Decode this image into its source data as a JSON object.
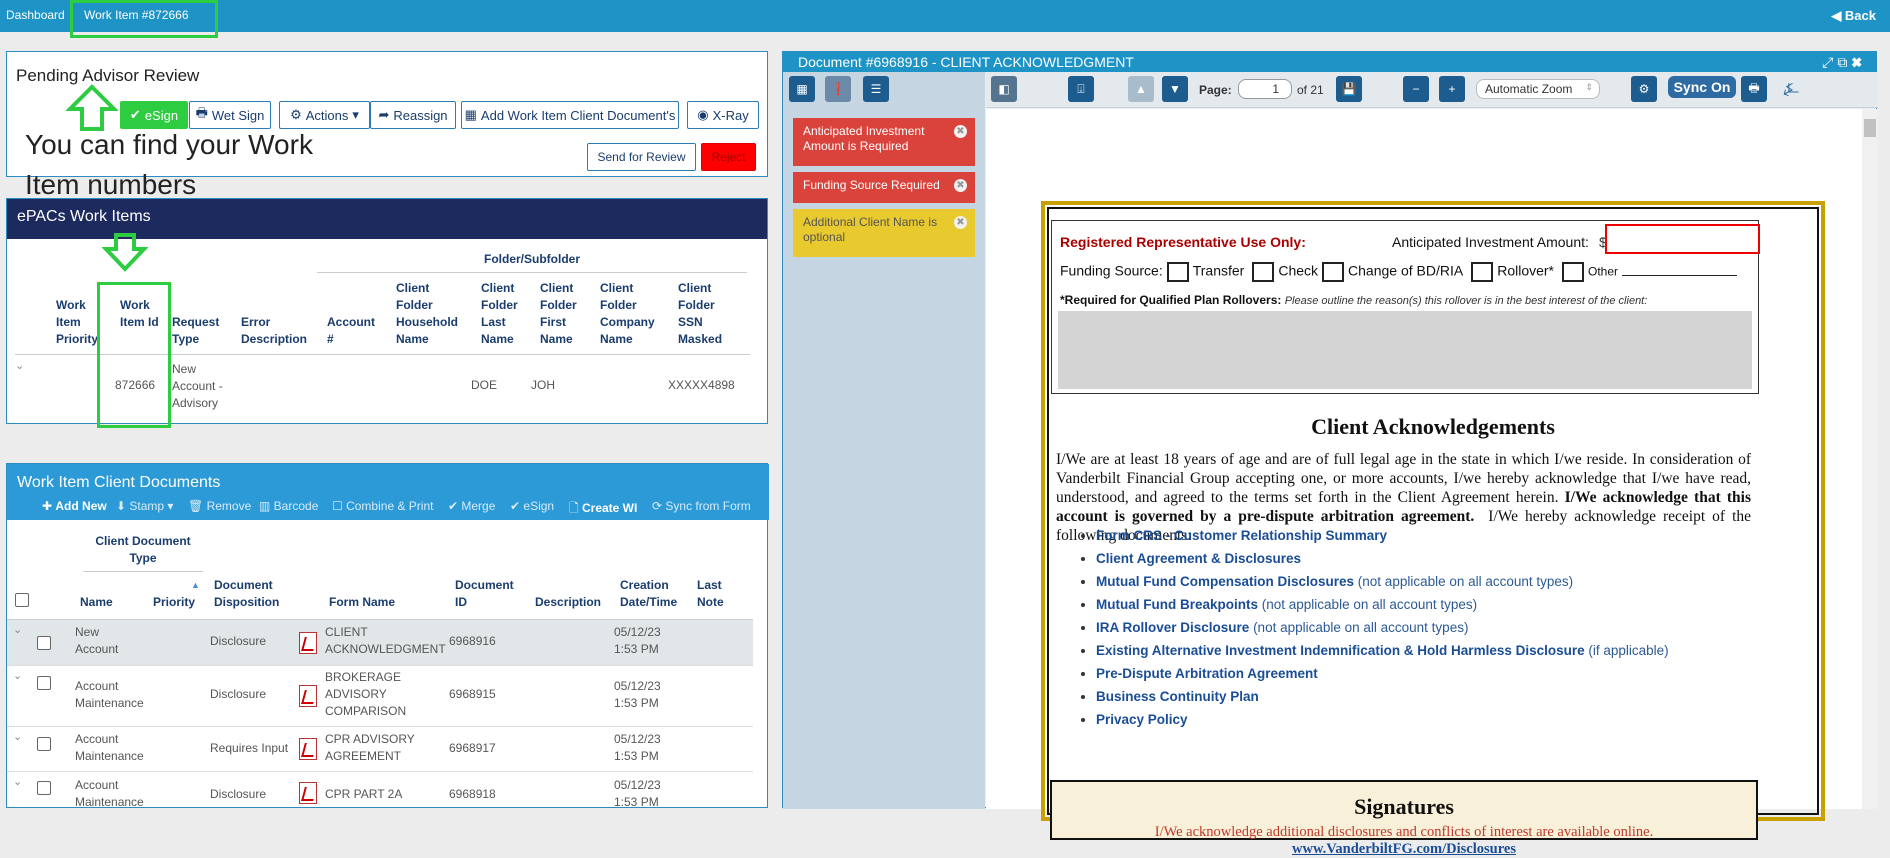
{
  "topbar": {
    "dashboard": "Dashboard",
    "work_item": "Work Item #872666",
    "back": "Back"
  },
  "pending": {
    "title": "Pending Advisor Review",
    "buttons": {
      "esign": "eSign",
      "wetsign": "Wet Sign",
      "actions": "Actions",
      "reassign": "Reassign",
      "add_docs": "Add Work Item Client Document's",
      "xray": "X-Ray"
    },
    "send_review": "Send for Review",
    "reject": "Reject",
    "annotation": "You can find your Work Item numbers"
  },
  "epacs": {
    "title": "ePACs Work Items",
    "folder_header": "Folder/Subfolder",
    "columns": [
      "Work Item Priority",
      "Work Item Id",
      "Request Type",
      "Error Description",
      "Account #",
      "Client Folder Household Name",
      "Client Folder Last Name",
      "Client Folder First Name",
      "Client Folder Company Name",
      "Client Folder SSN Masked"
    ],
    "row": {
      "id": "872666",
      "request_type": "New Account - Advisory",
      "last_name": "DOE",
      "first_name": "JOH",
      "ssn": "XXXXX4898"
    }
  },
  "docs": {
    "title": "Work Item Client Documents",
    "toolbar": [
      "Add New",
      "Stamp",
      "Remove",
      "Barcode",
      "Combine & Print",
      "Merge",
      "eSign",
      "Create WI",
      "Sync from Form"
    ],
    "group_header": "Client Document Type",
    "columns": {
      "name": "Name",
      "priority": "Priority",
      "disposition": "Document Disposition",
      "form": "Form Name",
      "docid": "Document ID",
      "desc": "Description",
      "created": "Creation Date/Time",
      "lastnote": "Last Note"
    },
    "rows": [
      {
        "name": "New Account",
        "disposition": "Disclosure",
        "form": "CLIENT ACKNOWLEDGMENT",
        "docid": "6968916",
        "date": "05/12/23",
        "time": "1:53 PM"
      },
      {
        "name": "Account Maintenance",
        "disposition": "Disclosure",
        "form": "BROKERAGE ADVISORY COMPARISON",
        "docid": "6968915",
        "date": "05/12/23",
        "time": "1:53 PM"
      },
      {
        "name": "Account Maintenance",
        "disposition": "Requires Input",
        "form": "CPR ADVISORY AGREEMENT",
        "docid": "6968917",
        "date": "05/12/23",
        "time": "1:53 PM"
      },
      {
        "name": "Account Maintenance",
        "disposition": "Disclosure",
        "form": "CPR PART 2A",
        "docid": "6968918",
        "date": "05/12/23",
        "time": "1:53 PM"
      }
    ]
  },
  "document": {
    "title": "Document #6968916 - CLIENT ACKNOWLEDGMENT",
    "page_label": "Page:",
    "page": "1",
    "of": "of 21",
    "zoom": "Automatic Zoom",
    "sync": "Sync On",
    "alerts": [
      {
        "text": "Anticipated Investment Amount is Required",
        "color": "#d9433b"
      },
      {
        "text": "Funding Source Required",
        "color": "#d9433b"
      },
      {
        "text": "Additional Client Name is optional",
        "color": "#e8c92e"
      }
    ],
    "form": {
      "rep_only": "Registered Representative Use Only:",
      "anticipated": "Anticipated Investment Amount:",
      "dollar": "$",
      "funding": "Funding Source:",
      "transfer": "Transfer",
      "check": "Check",
      "change": "Change of BD/RIA",
      "rollover": "Rollover*",
      "other": "Other",
      "required_label": "*Required for Qualified Plan Rollovers:",
      "required_text": "Please outline the reason(s) this rollover is in the best interest of the client:"
    },
    "heading": "Client Acknowledgements",
    "para1": "I/We are at least 18 years of age and are of full legal age in the state in which I/we reside. In consideration of Vanderbilt Financial Group accepting one, or more accounts, I/we hereby acknowledge that I/we have read, understood, and agreed to the terms set forth in the Client Agreement herein.",
    "para_bold": "I/We acknowledge that this account is governed by a pre-dispute arbitration agreement.",
    "para2": "I/We hereby acknowledge receipt of the following documents:",
    "list": [
      {
        "link": "Form CRS - Customer Relationship Summary",
        "note": ""
      },
      {
        "link": "Client Agreement & Disclosures",
        "note": ""
      },
      {
        "link": "Mutual Fund Compensation Disclosures",
        "note": "(not applicable on all account types)"
      },
      {
        "link": "Mutual Fund Breakpoints",
        "note": "(not applicable on all account types)"
      },
      {
        "link": "IRA Rollover Disclosure",
        "note": "(not applicable on all account types)"
      },
      {
        "link": "Existing Alternative Investment Indemnification & Hold Harmless Disclosure",
        "note": "(if applicable)"
      },
      {
        "link": "Pre-Dispute Arbitration Agreement",
        "note": ""
      },
      {
        "link": "Business Continuity Plan",
        "note": ""
      },
      {
        "link": "Privacy Policy",
        "note": ""
      }
    ],
    "signatures": "Signatures",
    "sig_note": "I/We acknowledge additional disclosures and conflicts of interest are available online.",
    "sig_url": "www.VanderbiltFG.com/Disclosures"
  }
}
